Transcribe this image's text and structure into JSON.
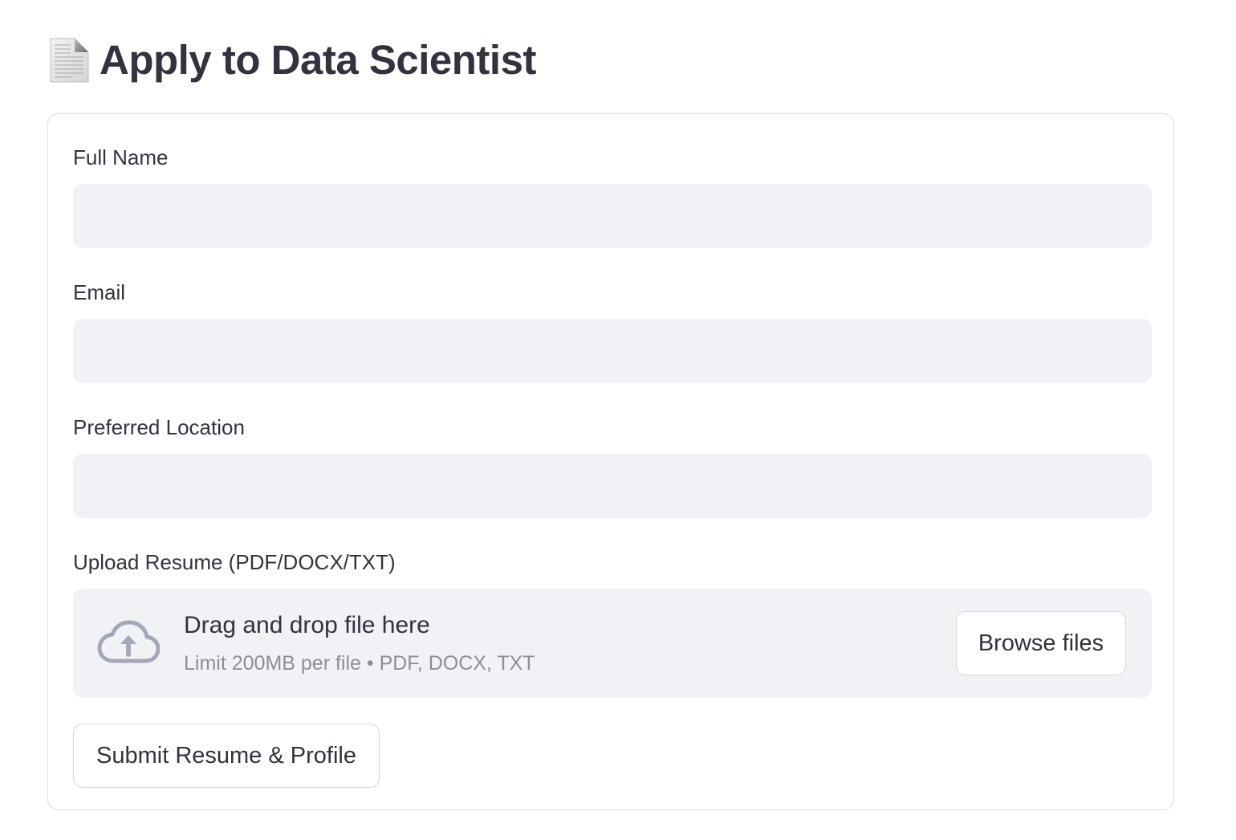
{
  "page": {
    "title": "Apply to Data Scientist",
    "title_icon": "document-icon"
  },
  "form": {
    "full_name": {
      "label": "Full Name",
      "value": "",
      "placeholder": ""
    },
    "email": {
      "label": "Email",
      "value": "",
      "placeholder": ""
    },
    "location": {
      "label": "Preferred Location",
      "value": "",
      "placeholder": ""
    },
    "resume": {
      "label": "Upload Resume (PDF/DOCX/TXT)",
      "dropzone_title": "Drag and drop file here",
      "dropzone_subtitle": "Limit 200MB per file • PDF, DOCX, TXT",
      "upload_icon": "cloud-upload-icon",
      "browse_label": "Browse files"
    },
    "submit_label": "Submit Resume & Profile"
  },
  "colors": {
    "text": "#31333f",
    "input_bg": "#f0f2f6",
    "border": "#dcdde1",
    "muted_text": "#8c8f99",
    "icon": "#a3a8b8"
  }
}
